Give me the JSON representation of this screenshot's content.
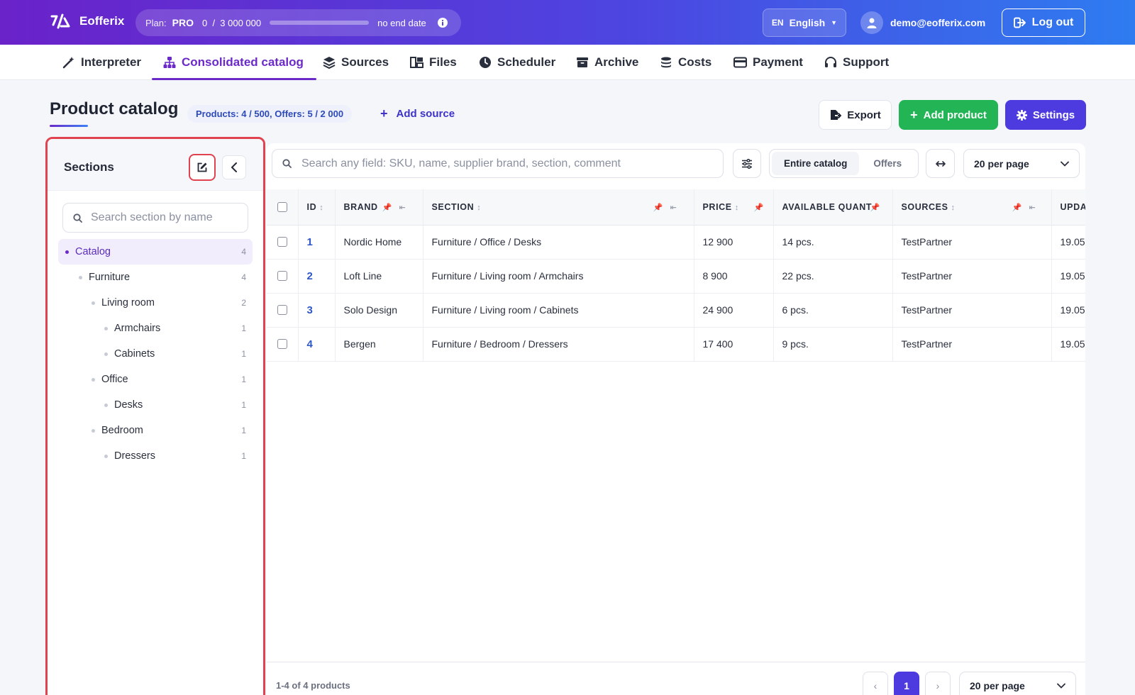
{
  "app": {
    "name": "Eofferix"
  },
  "plan": {
    "label": "Plan:",
    "tier": "PRO",
    "usage": "0  /  3 000 000",
    "usage_fraction": 0,
    "expiry": "no end date"
  },
  "language": {
    "code": "EN",
    "name": "English"
  },
  "user": {
    "email": "demo@eofferix.com"
  },
  "logout_label": "Log out",
  "nav": [
    {
      "label": "Interpreter",
      "icon": "magic-wand-icon"
    },
    {
      "label": "Consolidated catalog",
      "icon": "sitemap-icon",
      "active": true
    },
    {
      "label": "Sources",
      "icon": "layers-icon"
    },
    {
      "label": "Files",
      "icon": "files-icon"
    },
    {
      "label": "Scheduler",
      "icon": "clock-icon"
    },
    {
      "label": "Archive",
      "icon": "archive-icon"
    },
    {
      "label": "Costs",
      "icon": "coins-icon"
    },
    {
      "label": "Payment",
      "icon": "credit-card-icon"
    },
    {
      "label": "Support",
      "icon": "headset-icon"
    }
  ],
  "page": {
    "title": "Product catalog",
    "counts": "Products: 4 / 500, Offers: 5 / 2 000",
    "add_source": "Add source",
    "export": "Export",
    "add_product": "Add product",
    "settings": "Settings"
  },
  "sidebar": {
    "title": "Sections",
    "search_placeholder": "Search section by name",
    "tree": [
      {
        "label": "Catalog",
        "count": "4",
        "level": 0,
        "active": true
      },
      {
        "label": "Furniture",
        "count": "4",
        "level": 1
      },
      {
        "label": "Living room",
        "count": "2",
        "level": 2
      },
      {
        "label": "Armchairs",
        "count": "1",
        "level": 3
      },
      {
        "label": "Cabinets",
        "count": "1",
        "level": 3
      },
      {
        "label": "Office",
        "count": "1",
        "level": 2
      },
      {
        "label": "Desks",
        "count": "1",
        "level": 3
      },
      {
        "label": "Bedroom",
        "count": "1",
        "level": 2
      },
      {
        "label": "Dressers",
        "count": "1",
        "level": 3
      }
    ]
  },
  "toolbar": {
    "search_placeholder": "Search any field: SKU, name, supplier brand, section, comment",
    "scope_entire": "Entire catalog",
    "scope_offers": "Offers",
    "per_page": "20 per page"
  },
  "table": {
    "columns": [
      "ID",
      "BRAND",
      "SECTION",
      "PRICE",
      "AVAILABLE QUANT",
      "SOURCES",
      "UPDA"
    ],
    "rows": [
      {
        "id": "1",
        "brand": "Nordic Home",
        "section": "Furniture / Office / Desks",
        "price": "12 900",
        "qty": "14 pcs.",
        "source": "TestPartner",
        "updated": "19.05"
      },
      {
        "id": "2",
        "brand": "Loft Line",
        "section": "Furniture / Living room / Armchairs",
        "price": "8 900",
        "qty": "22 pcs.",
        "source": "TestPartner",
        "updated": "19.05"
      },
      {
        "id": "3",
        "brand": "Solo Design",
        "section": "Furniture / Living room / Cabinets",
        "price": "24 900",
        "qty": "6 pcs.",
        "source": "TestPartner",
        "updated": "19.05"
      },
      {
        "id": "4",
        "brand": "Bergen",
        "section": "Furniture / Bedroom / Dressers",
        "price": "17 400",
        "qty": "9 pcs.",
        "source": "TestPartner",
        "updated": "19.05"
      }
    ]
  },
  "pagination": {
    "info": "1-4 of 4 products",
    "current": "1",
    "prev": "‹",
    "next": "›",
    "per_page": "20 per page"
  }
}
